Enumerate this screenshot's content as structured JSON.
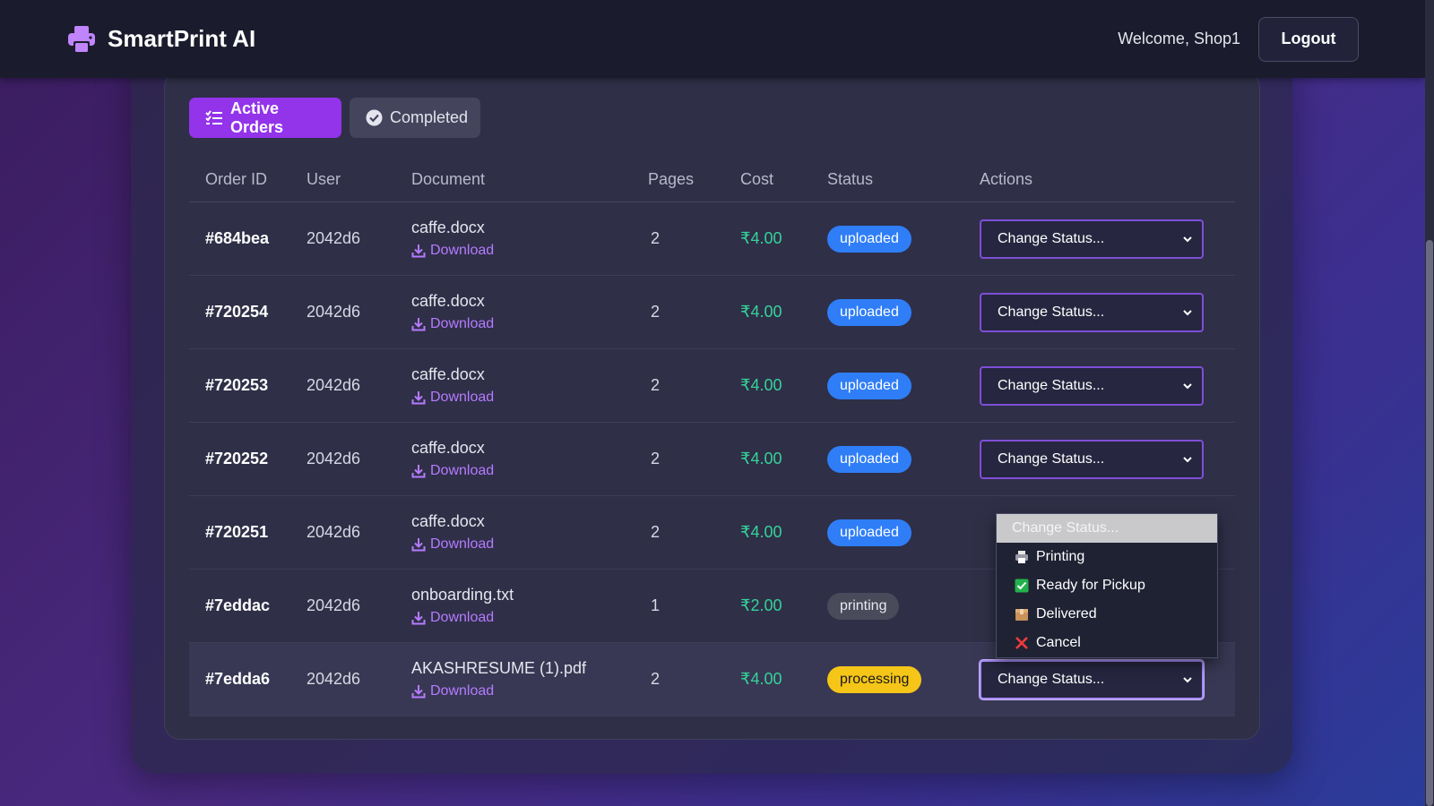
{
  "navbar": {
    "brand": "SmartPrint AI",
    "welcome": "Welcome, Shop1",
    "logout_label": "Logout"
  },
  "tabs": [
    {
      "label": "Active Orders",
      "active": true,
      "icon": "list-check-icon"
    },
    {
      "label": "Completed",
      "active": false,
      "icon": "check-circle-icon"
    }
  ],
  "table": {
    "headers": [
      "Order ID",
      "User",
      "Document",
      "Pages",
      "Cost",
      "Status",
      "Actions"
    ],
    "download_label": "Download",
    "select_placeholder": "Change Status...",
    "rows": [
      {
        "id": "#684bea",
        "user": "2042d6",
        "document": "caffe.docx",
        "pages": "2",
        "cost": "₹4.00",
        "status": "uploaded"
      },
      {
        "id": "#720254",
        "user": "2042d6",
        "document": "caffe.docx",
        "pages": "2",
        "cost": "₹4.00",
        "status": "uploaded"
      },
      {
        "id": "#720253",
        "user": "2042d6",
        "document": "caffe.docx",
        "pages": "2",
        "cost": "₹4.00",
        "status": "uploaded"
      },
      {
        "id": "#720252",
        "user": "2042d6",
        "document": "caffe.docx",
        "pages": "2",
        "cost": "₹4.00",
        "status": "uploaded"
      },
      {
        "id": "#720251",
        "user": "2042d6",
        "document": "caffe.docx",
        "pages": "2",
        "cost": "₹4.00",
        "status": "uploaded"
      },
      {
        "id": "#7eddac",
        "user": "2042d6",
        "document": "onboarding.txt",
        "pages": "1",
        "cost": "₹2.00",
        "status": "printing"
      },
      {
        "id": "#7edda6",
        "user": "2042d6",
        "document": "AKASHRESUME (1).pdf",
        "pages": "2",
        "cost": "₹4.00",
        "status": "processing"
      }
    ]
  },
  "dropdown": {
    "options": [
      {
        "label": "Change Status...",
        "icon": ""
      },
      {
        "label": "Printing",
        "icon": "printer-icon"
      },
      {
        "label": "Ready for Pickup",
        "icon": "green-check-icon"
      },
      {
        "label": "Delivered",
        "icon": "package-icon"
      },
      {
        "label": "Cancel",
        "icon": "red-x-icon"
      }
    ]
  },
  "colors": {
    "accent": "#9333ea",
    "uploaded": "#2f7ef7",
    "printing": "#4a4b5a",
    "processing": "#f5c518",
    "cost": "#34d399",
    "link": "#b57bff"
  }
}
